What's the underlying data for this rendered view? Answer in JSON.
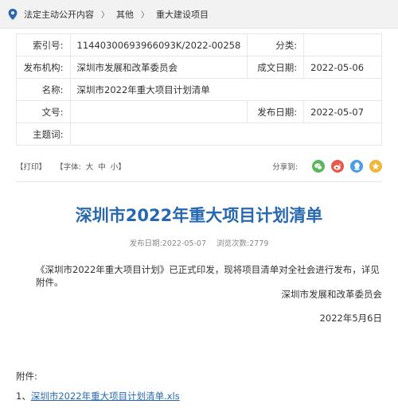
{
  "breadcrumb": {
    "items": [
      "法定主动公开内容",
      "其他",
      "重大建设项目"
    ],
    "separator": "〉"
  },
  "meta": {
    "index_label": "索引号:",
    "index_value": "11440300693966093K/2022-00258",
    "category_label": "分类:",
    "category_value": "",
    "publisher_label": "发布机构:",
    "publisher_value": "深圳市发展和改革委员会",
    "written_date_label": "成文日期:",
    "written_date_value": "2022-05-06",
    "name_label": "名称:",
    "name_value": "深圳市2022年重大项目计划清单",
    "doc_no_label": "文号:",
    "doc_no_value": "",
    "publish_date_label": "发布日期:",
    "publish_date_value": "2022-05-07",
    "subject_label": "主题词:",
    "subject_value": ""
  },
  "toolbar": {
    "print_label": "打印",
    "font_label": "字体:",
    "font_large": "大",
    "font_medium": "中",
    "font_small": "小",
    "share_label": "分享到:",
    "share_icons": [
      "wechat-icon",
      "weibo-icon",
      "qq-icon",
      "qzone-icon"
    ]
  },
  "article": {
    "title": "深圳市2022年重大项目计划清单",
    "publish_date_label": "发布日期:",
    "publish_date": "2022-05-07",
    "views_label": "浏览次数:",
    "views": "2779",
    "body": "《深圳市2022年重大项目计划》已正式印发，现将项目清单对全社会进行发布，详见附件。",
    "signature": "深圳市发展和改革委员会",
    "date": "2022年5月6日"
  },
  "attachments": {
    "label": "附件:",
    "items": [
      {
        "index": "1、",
        "name": "深圳市2022年重大项目计划清单.xls"
      }
    ]
  },
  "colors": {
    "title_blue": "#2768b0",
    "link_blue": "#2768b0",
    "breadcrumb_bg": "#f2f2f2",
    "wechat": "#5bb75b",
    "weibo": "#e8574a",
    "qq": "#4a9de6",
    "qzone": "#f2b53a"
  }
}
